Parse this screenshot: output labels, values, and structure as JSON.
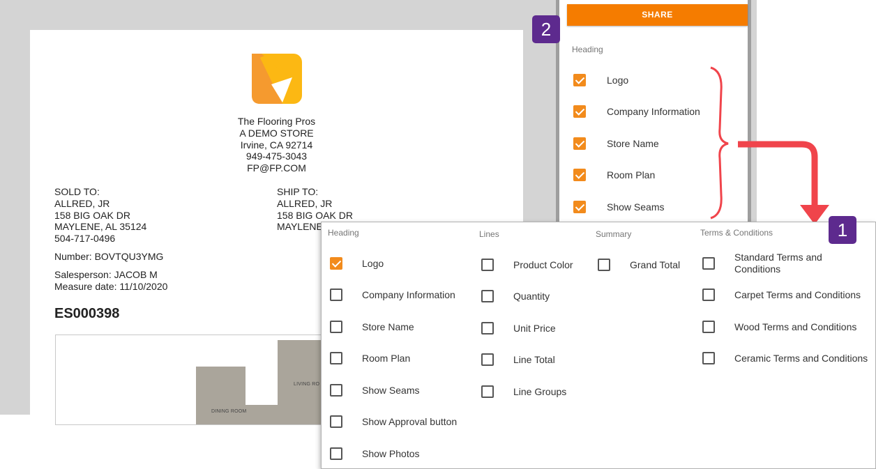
{
  "document": {
    "company_lines": [
      "The Flooring Pros",
      "A DEMO STORE",
      "Irvine, CA 92714",
      "949-475-3043",
      "FP@FP.COM"
    ],
    "sold_to": [
      "SOLD TO:",
      "ALLRED, JR",
      "158 BIG OAK DR",
      "MAYLENE, AL 35124",
      "504-717-0496"
    ],
    "ship_to": [
      "SHIP TO:",
      "ALLRED, JR",
      "158 BIG OAK DR",
      "MAYLENE,"
    ],
    "number": "Number: BOVTQU3YMG",
    "salesperson": "Salesperson: JACOB M",
    "measure_date": "Measure date: 11/10/2020",
    "estimate_id": "ES000398",
    "room_labels": [
      "LIVING RO",
      "DINING ROOM"
    ]
  },
  "share_panel": {
    "share_label": "SHARE",
    "heading": "Heading",
    "items": [
      {
        "label": "Logo",
        "checked": true
      },
      {
        "label": "Company Information",
        "checked": true
      },
      {
        "label": "Store Name",
        "checked": true
      },
      {
        "label": "Room Plan",
        "checked": true
      },
      {
        "label": "Show Seams",
        "checked": true
      }
    ]
  },
  "badges": {
    "one": "1",
    "two": "2"
  },
  "options": {
    "heading": {
      "title": "Heading",
      "items": [
        {
          "label": "Logo",
          "checked": true
        },
        {
          "label": "Company Information",
          "checked": false
        },
        {
          "label": "Store Name",
          "checked": false
        },
        {
          "label": "Room Plan",
          "checked": false
        },
        {
          "label": "Show Seams",
          "checked": false
        },
        {
          "label": "Show Approval button",
          "checked": false
        },
        {
          "label": "Show Photos",
          "checked": false
        }
      ]
    },
    "lines": {
      "title": "Lines",
      "items": [
        {
          "label": "Product Color",
          "checked": false
        },
        {
          "label": "Quantity",
          "checked": false
        },
        {
          "label": "Unit Price",
          "checked": false
        },
        {
          "label": "Line Total",
          "checked": false
        },
        {
          "label": "Line Groups",
          "checked": false
        }
      ]
    },
    "summary": {
      "title": "Summary",
      "items": [
        {
          "label": "Grand Total",
          "checked": false
        }
      ]
    },
    "terms": {
      "title": "Terms & Conditions",
      "items": [
        {
          "label": "Standard Terms and Conditions",
          "checked": false
        },
        {
          "label": "Carpet Terms and Conditions",
          "checked": false
        },
        {
          "label": "Wood Terms and Conditions",
          "checked": false
        },
        {
          "label": "Ceramic Terms and Conditions",
          "checked": false
        }
      ]
    }
  },
  "colors": {
    "accent": "#f57c00",
    "badge": "#5d2a8e",
    "arrow": "#f0444b",
    "logo_orange": "#f59a2f",
    "logo_yellow": "#fcb813"
  }
}
